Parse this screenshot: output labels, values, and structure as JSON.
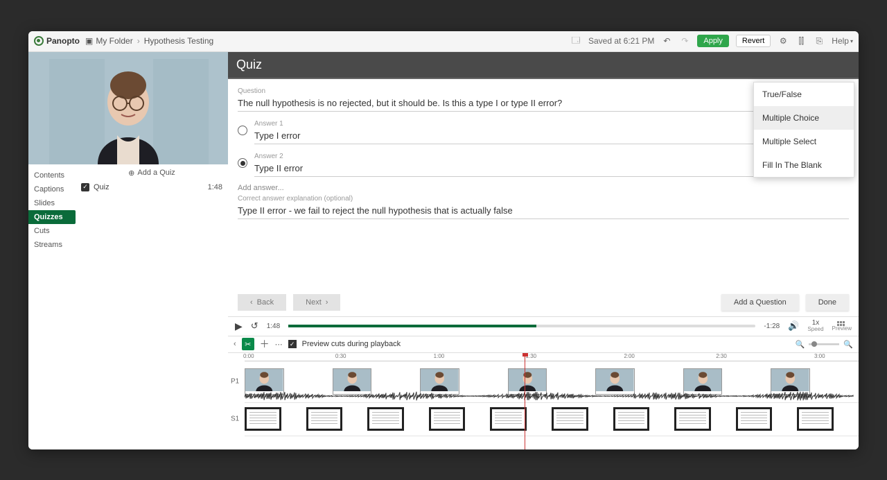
{
  "brand": "Panopto",
  "breadcrumb": {
    "folder": "My Folder",
    "title": "Hypothesis Testing"
  },
  "topbar": {
    "saved": "Saved at 6:21 PM",
    "apply": "Apply",
    "revert": "Revert",
    "help": "Help"
  },
  "sidebar": {
    "items": [
      "Contents",
      "Captions",
      "Slides",
      "Quizzes",
      "Cuts",
      "Streams"
    ],
    "active": "Quizzes",
    "add_quiz": "Add a Quiz",
    "quiz_item": {
      "name": "Quiz",
      "time": "1:48"
    }
  },
  "quiz": {
    "header": "Quiz",
    "question_label": "Question",
    "question": "The null hypothesis is no rejected, but it should be. Is this a type I or type II error?",
    "answers": [
      {
        "label": "Answer 1",
        "text": "Type I error",
        "selected": false
      },
      {
        "label": "Answer 2",
        "text": "Type II error",
        "selected": true
      }
    ],
    "add_answer": "Add answer...",
    "explanation_label": "Correct answer explanation (optional)",
    "explanation": "Type II error - we fail to reject the null hypothesis that is actually false",
    "type_options": [
      "True/False",
      "Multiple Choice",
      "Multiple Select",
      "Fill In The Blank"
    ],
    "type_selected": "Multiple Choice"
  },
  "nav": {
    "back": "Back",
    "next": "Next",
    "add_q": "Add a Question",
    "done": "Done"
  },
  "player": {
    "current": "1:48",
    "remaining": "-1:28",
    "speed": "1x",
    "speed_label": "Speed",
    "preview_label": "Preview"
  },
  "timeline": {
    "preview_cuts": "Preview cuts during playback",
    "marks": [
      "0:00",
      "0:30",
      "1:00",
      "1:30",
      "2:00",
      "2:30",
      "3:00"
    ],
    "tracks": {
      "p1": "P1",
      "s1": "S1"
    },
    "playhead_pct": 47
  }
}
